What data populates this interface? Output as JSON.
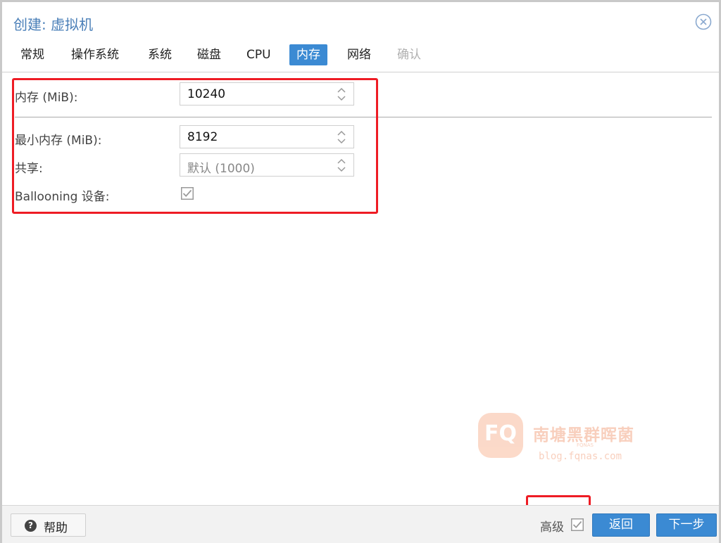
{
  "dialog": {
    "title": "创建: 虚拟机"
  },
  "tabs": [
    {
      "label": "常规",
      "state": "normal"
    },
    {
      "label": "操作系统",
      "state": "normal"
    },
    {
      "label": "系统",
      "state": "normal"
    },
    {
      "label": "磁盘",
      "state": "normal"
    },
    {
      "label": "CPU",
      "state": "normal"
    },
    {
      "label": "内存",
      "state": "active"
    },
    {
      "label": "网络",
      "state": "normal"
    },
    {
      "label": "确认",
      "state": "disabled"
    }
  ],
  "memory": {
    "memory_label": "内存 (MiB):",
    "memory_value": "10240",
    "min_memory_label": "最小内存 (MiB):",
    "min_memory_value": "8192",
    "shares_label": "共享:",
    "shares_value": "默认 (1000)",
    "ballooning_label": "Ballooning 设备:",
    "ballooning_checked": true
  },
  "watermark": {
    "logo_text": "FQ",
    "title": "南塘黑群晖菌",
    "subtitle": "FQNAS",
    "url": "blog.fqnas.com"
  },
  "footer": {
    "help_label": "帮助",
    "advanced_label": "高级",
    "advanced_checked": true,
    "back_label": "返回",
    "next_label": "下一步"
  },
  "colors": {
    "accent": "#3b8ad3",
    "title": "#4a7fb8",
    "highlight": "#ee1c24",
    "watermark": "#f08a5d"
  }
}
